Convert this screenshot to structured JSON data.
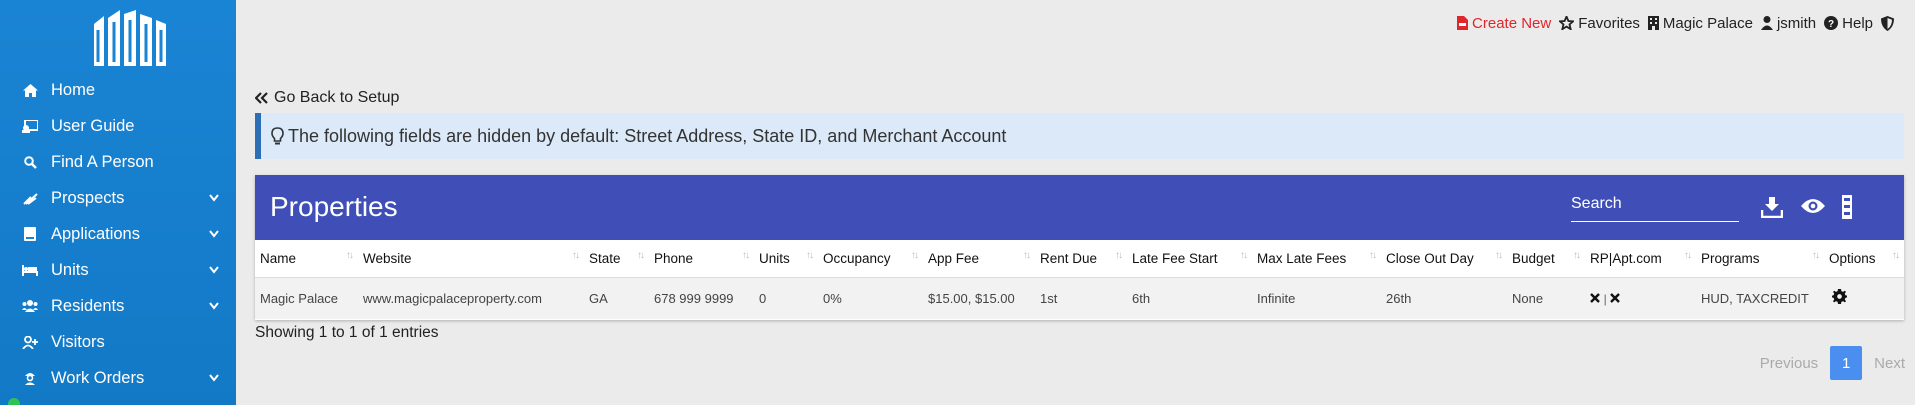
{
  "sidebar": {
    "items": [
      {
        "label": "Home",
        "icon": "home-icon",
        "has_chevron": false
      },
      {
        "label": "User Guide",
        "icon": "user-guide-icon",
        "has_chevron": false
      },
      {
        "label": "Find A Person",
        "icon": "search-icon",
        "has_chevron": false
      },
      {
        "label": "Prospects",
        "icon": "prospects-icon",
        "has_chevron": true
      },
      {
        "label": "Applications",
        "icon": "book-icon",
        "has_chevron": true
      },
      {
        "label": "Units",
        "icon": "bed-icon",
        "has_chevron": true
      },
      {
        "label": "Residents",
        "icon": "users-icon",
        "has_chevron": true
      },
      {
        "label": "Visitors",
        "icon": "user-plus-icon",
        "has_chevron": false
      },
      {
        "label": "Work Orders",
        "icon": "worker-icon",
        "has_chevron": true
      }
    ]
  },
  "topbar": {
    "create_new": "Create New",
    "favorites": "Favorites",
    "property": "Magic Palace",
    "user": "jsmith",
    "help": "Help"
  },
  "go_back": "Go Back to Setup",
  "alert": "The following fields are hidden by default: Street Address, State ID, and Merchant Account",
  "card": {
    "title": "Properties",
    "search_label": "Search"
  },
  "table": {
    "columns": [
      "Name",
      "Website",
      "State",
      "Phone",
      "Units",
      "Occupancy",
      "App Fee",
      "Rent Due",
      "Late Fee Start",
      "Max Late Fees",
      "Close Out Day",
      "Budget",
      "RP|Apt.com",
      "Programs",
      "Options"
    ],
    "rows": [
      {
        "name": "Magic Palace",
        "website": "www.magicpalaceproperty.com",
        "state": "GA",
        "phone": "678 999 9999",
        "units": "0",
        "occupancy": "0%",
        "app_fee": "$15.00, $15.00",
        "rent_due": "1st",
        "late_fee_start": "6th",
        "max_late_fees": "Infinite",
        "close_out_day": "26th",
        "budget": "None",
        "rp_separator": "|",
        "programs": "HUD, TAXCREDIT"
      }
    ]
  },
  "showing": "Showing 1 to 1 of 1 entries",
  "pager": {
    "previous": "Previous",
    "current": "1",
    "next": "Next"
  },
  "colors": {
    "sidebar": "#1a84d4",
    "header": "#3f4fb7",
    "alert_bg": "#dbe9f8",
    "create_new": "#e0262a",
    "pager_active": "#4a8ff0"
  }
}
